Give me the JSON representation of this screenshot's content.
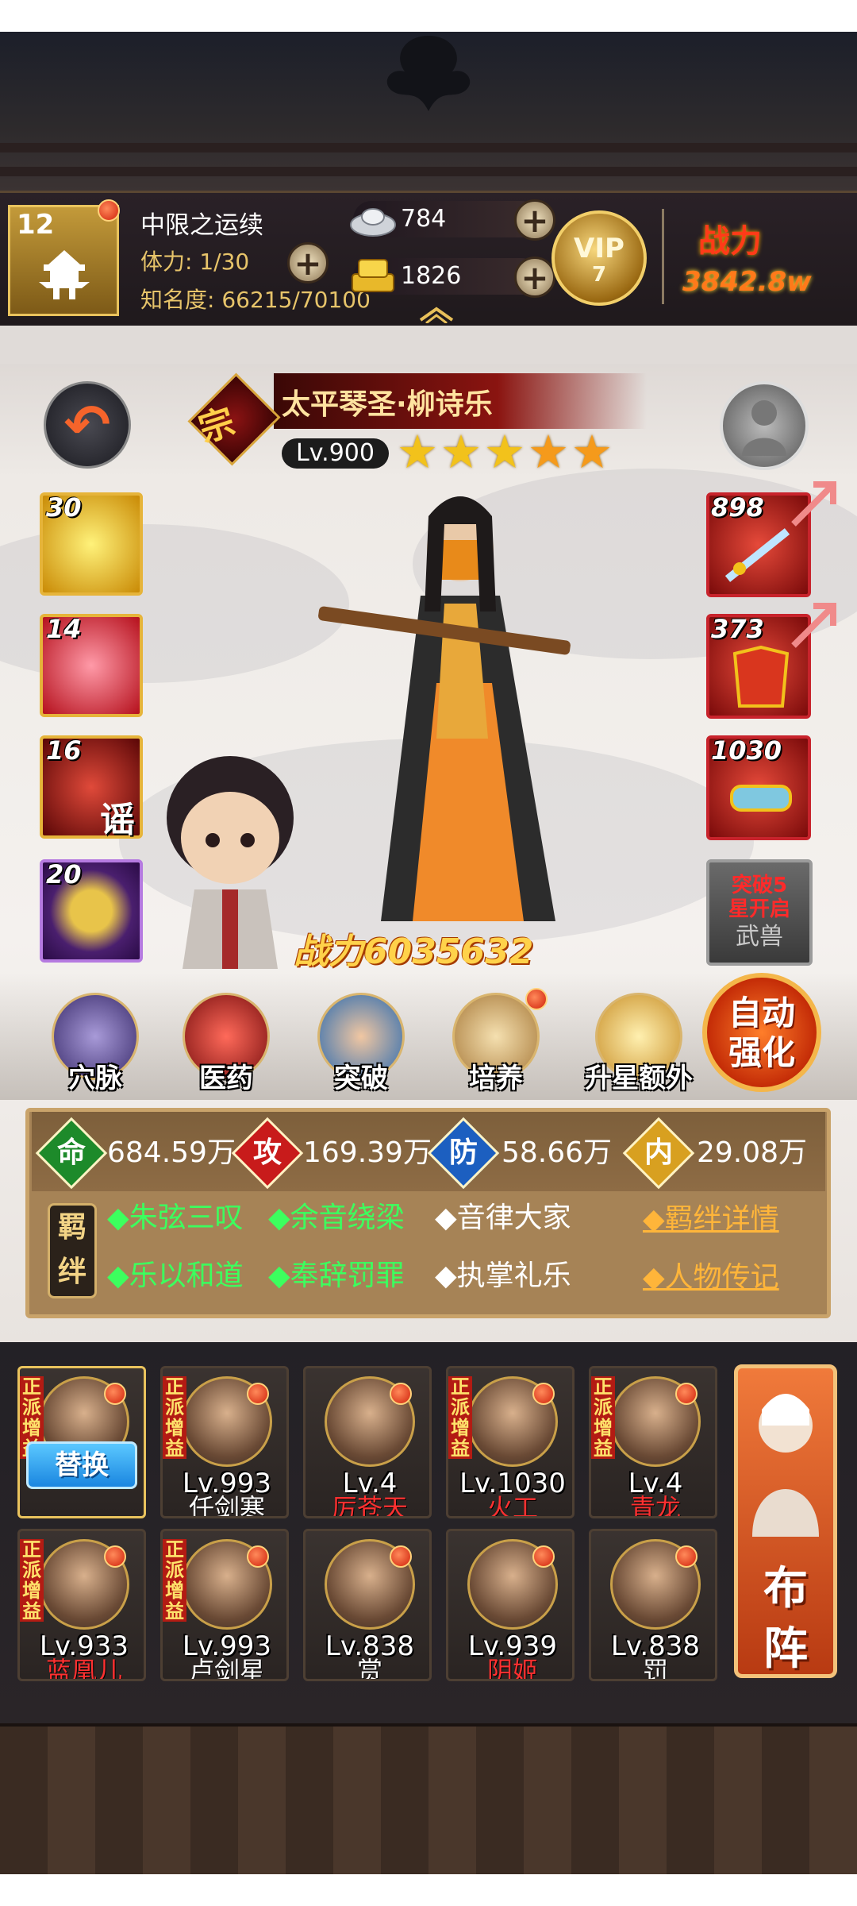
{
  "header": {
    "player_level": "12",
    "player_name": "中限之运续",
    "stamina_label": "体力: 1/30",
    "fame_label": "知名度: 66215/70100",
    "silver": "784",
    "gold": "1826",
    "vip_label": "VIP",
    "vip_level": "7",
    "power_label": "战力",
    "power_value": "3842.8w"
  },
  "hero": {
    "faction_char": "宗",
    "title_name": "太平琴圣·柳诗乐",
    "level": "Lv.900",
    "stars": 5,
    "combat_power": "战力6035632"
  },
  "skills": [
    {
      "level": "30",
      "icon": "gold-swirl-skill-icon",
      "color": "#e8c21a"
    },
    {
      "level": "14",
      "icon": "red-heart-skill-icon",
      "color": "#e0303a"
    },
    {
      "level": "16",
      "icon": "red-rumor-skill-icon",
      "color": "#b01818",
      "glyph": "谣"
    },
    {
      "level": "20",
      "icon": "golden-orb-skill-icon",
      "color": "#6a2a9a"
    }
  ],
  "equipment": [
    {
      "level": "898",
      "icon": "weapon-icon"
    },
    {
      "level": "373",
      "icon": "armor-icon"
    },
    {
      "level": "1030",
      "icon": "scroll-icon"
    }
  ],
  "beast_slot": {
    "line1": "突破5",
    "line2": "星开启",
    "label": "武兽"
  },
  "functions": [
    {
      "label": "穴脉",
      "icon": "meridian-icon"
    },
    {
      "label": "医药",
      "icon": "medicine-icon"
    },
    {
      "label": "突破",
      "icon": "breakthrough-icon"
    },
    {
      "label": "培养",
      "icon": "cultivate-icon"
    },
    {
      "label": "升星额外",
      "icon": "star-up-icon"
    }
  ],
  "auto_enhance": {
    "line1": "自动",
    "line2": "强化"
  },
  "stats": [
    {
      "char": "命",
      "value": "684.59万",
      "color": "#1d8a2a"
    },
    {
      "char": "攻",
      "value": "169.39万",
      "color": "#c81b1b"
    },
    {
      "char": "防",
      "value": "58.66万",
      "color": "#1c5fc0"
    },
    {
      "char": "内",
      "value": "29.08万",
      "color": "#d8a020"
    }
  ],
  "bonds": {
    "tag": "羁绊",
    "row1": [
      "◆朱弦三叹",
      "◆余音绕梁",
      "◆音律大家"
    ],
    "row2": [
      "◆乐以和道",
      "◆奉辞罚罪",
      "◆执掌礼乐"
    ],
    "detail_link": "◆羁绊详情",
    "bio_link": "◆人物传记"
  },
  "team": [
    {
      "level": "",
      "name": "",
      "tag": "正派增益",
      "selected": true
    },
    {
      "level": "Lv.993",
      "name": "任剑寒",
      "tag": "正派增益",
      "name_color": "#ffffff"
    },
    {
      "level": "Lv.4",
      "name": "厉苍天",
      "tag": "",
      "name_color": "#ff3030"
    },
    {
      "level": "Lv.1030",
      "name": "火工",
      "tag": "正派增益",
      "name_color": "#ff3030"
    },
    {
      "level": "Lv.4",
      "name": "青龙",
      "tag": "正派增益",
      "name_color": "#ff3030"
    },
    {
      "level": "Lv.933",
      "name": "蓝凰儿",
      "tag": "正派增益",
      "name_color": "#ff3030"
    },
    {
      "level": "Lv.993",
      "name": "卢剑星",
      "tag": "正派增益",
      "name_color": "#ffffff"
    },
    {
      "level": "Lv.838",
      "name": "赏",
      "tag": "",
      "name_color": "#ffffff"
    },
    {
      "level": "Lv.939",
      "name": "阴姬",
      "tag": "",
      "name_color": "#ff3030"
    },
    {
      "level": "Lv.838",
      "name": "罚",
      "tag": "",
      "name_color": "#ffffff"
    }
  ],
  "replace_button": "替换",
  "formation_button": {
    "line1": "布",
    "line2": "阵"
  }
}
